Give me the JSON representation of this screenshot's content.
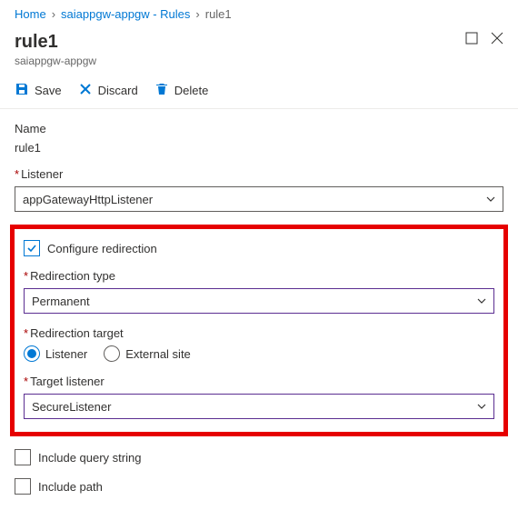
{
  "breadcrumb": {
    "home": "Home",
    "rules": "saiappgw-appgw - Rules",
    "current": "rule1"
  },
  "header": {
    "title": "rule1",
    "subtitle": "saiappgw-appgw"
  },
  "toolbar": {
    "save": "Save",
    "discard": "Discard",
    "delete": "Delete"
  },
  "form": {
    "name_label": "Name",
    "name_value": "rule1",
    "listener_label": "Listener",
    "listener_value": "appGatewayHttpListener",
    "configure_redirection": "Configure redirection",
    "redirection_type_label": "Redirection type",
    "redirection_type_value": "Permanent",
    "redirection_target_label": "Redirection target",
    "radio_listener": "Listener",
    "radio_external": "External site",
    "target_listener_label": "Target listener",
    "target_listener_value": "SecureListener",
    "include_query": "Include query string",
    "include_path": "Include path"
  }
}
